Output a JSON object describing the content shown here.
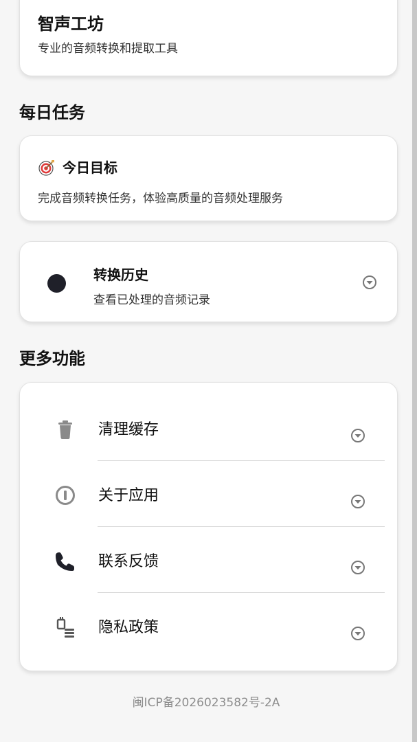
{
  "app": {
    "title": "智声工坊",
    "subtitle": "专业的音频转换和提取工具"
  },
  "daily": {
    "section_title": "每日任务",
    "goal": {
      "icon": "target-icon",
      "title": "今日目标",
      "description": "完成音频转换任务，体验高质量的音频处理服务"
    }
  },
  "history": {
    "icon": "dot-icon",
    "title": "转换历史",
    "subtitle": "查看已处理的音频记录"
  },
  "more": {
    "section_title": "更多功能",
    "items": [
      {
        "label": "清理缓存",
        "icon": "trash-icon"
      },
      {
        "label": "关于应用",
        "icon": "info-icon"
      },
      {
        "label": "联系反馈",
        "icon": "phone-icon"
      },
      {
        "label": "隐私政策",
        "icon": "privacy-icon"
      }
    ]
  },
  "footer": {
    "icp": "闽ICP备2026023582号-2A"
  },
  "colors": {
    "background": "#f6f6f6",
    "card": "#ffffff",
    "icon_gray": "#8a8a8a",
    "dark": "#1f2029"
  }
}
